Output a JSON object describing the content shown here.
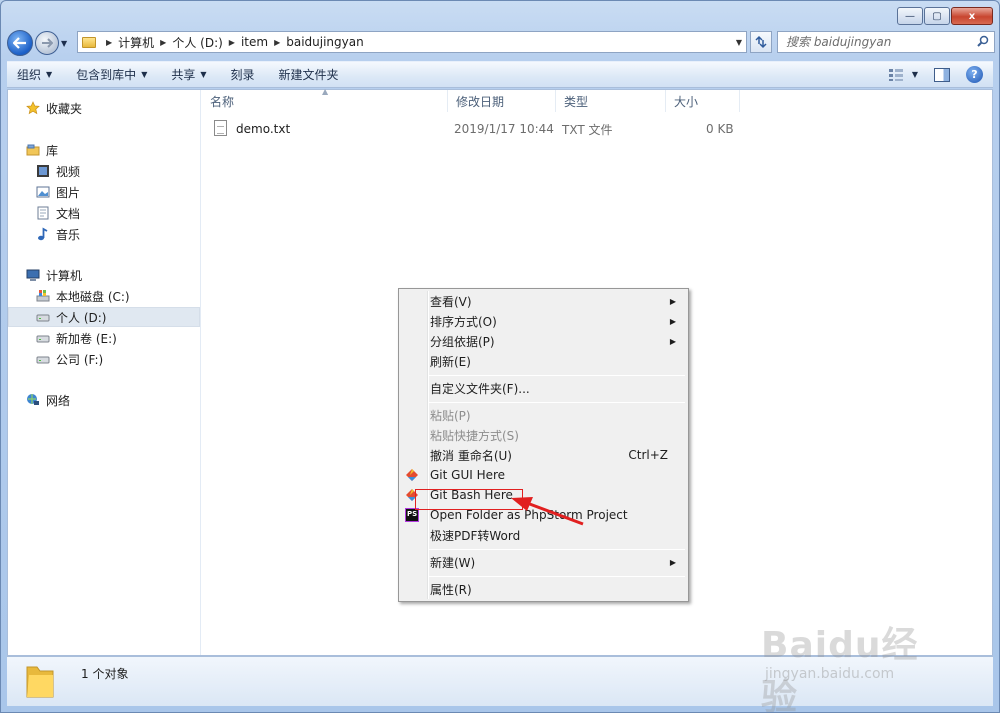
{
  "window": {
    "caption_buttons": [
      "—",
      "▢",
      "x"
    ]
  },
  "address": {
    "crumbs": [
      "计算机",
      "个人 (D:)",
      "item",
      "baidujingyan"
    ]
  },
  "search": {
    "placeholder": "搜索 baidujingyan"
  },
  "toolbar": {
    "organize": "组织",
    "include_library": "包含到库中",
    "share": "共享",
    "burn": "刻录",
    "new_folder": "新建文件夹",
    "help": "?"
  },
  "sidebar": {
    "favorites": "收藏夹",
    "library": "库",
    "video": "视频",
    "pictures": "图片",
    "documents": "文档",
    "music": "音乐",
    "computer": "计算机",
    "drive_c": "本地磁盘 (C:)",
    "drive_d": "个人 (D:)",
    "drive_e": "新加卷 (E:)",
    "drive_f": "公司 (F:)",
    "network": "网络"
  },
  "columns": {
    "name": "名称",
    "modified": "修改日期",
    "type": "类型",
    "size": "大小"
  },
  "files": [
    {
      "name": "demo.txt",
      "modified": "2019/1/17 10:44",
      "type": "TXT 文件",
      "size": "0 KB"
    }
  ],
  "context_menu": {
    "view": "查看(V)",
    "sort": "排序方式(O)",
    "group": "分组依据(P)",
    "refresh": "刷新(E)",
    "customize": "自定义文件夹(F)...",
    "paste": "粘贴(P)",
    "paste_shortcut": "粘贴快捷方式(S)",
    "undo": "撤消 重命名(U)",
    "undo_shortcut": "Ctrl+Z",
    "git_gui": "Git GUI Here",
    "git_bash": "Git Bash Here",
    "phpstorm": "Open Folder as PhpStorm Project",
    "pdf_word": "极速PDF转Word",
    "new": "新建(W)",
    "properties": "属性(R)",
    "phpstorm_badge": "PS"
  },
  "status": {
    "count": "1 个对象"
  },
  "watermark": {
    "main": "Baidu经验",
    "sub": "jingyan.baidu.com"
  },
  "colors": {
    "highlight": "#e12020",
    "accent": "#1b5fc7"
  }
}
